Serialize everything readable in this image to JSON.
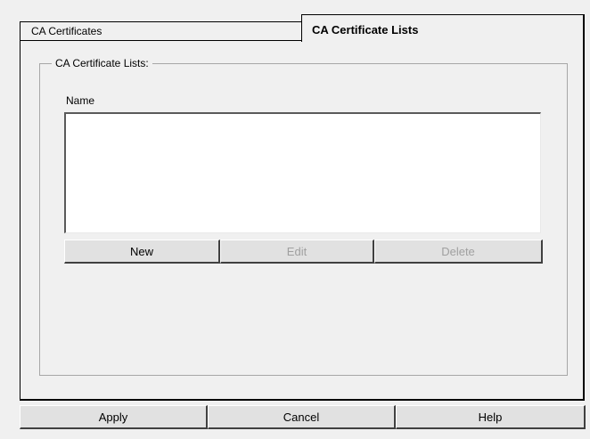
{
  "tabs": {
    "ca_certificates": "CA Certificates",
    "ca_certificate_lists": "CA Certificate Lists",
    "active": "CA Certificate Lists"
  },
  "group": {
    "legend": "CA Certificate Lists:",
    "column_header": "Name",
    "items": []
  },
  "list_buttons": {
    "new": "New",
    "edit": "Edit",
    "delete": "Delete"
  },
  "dialog_buttons": {
    "apply": "Apply",
    "cancel": "Cancel",
    "help": "Help"
  }
}
